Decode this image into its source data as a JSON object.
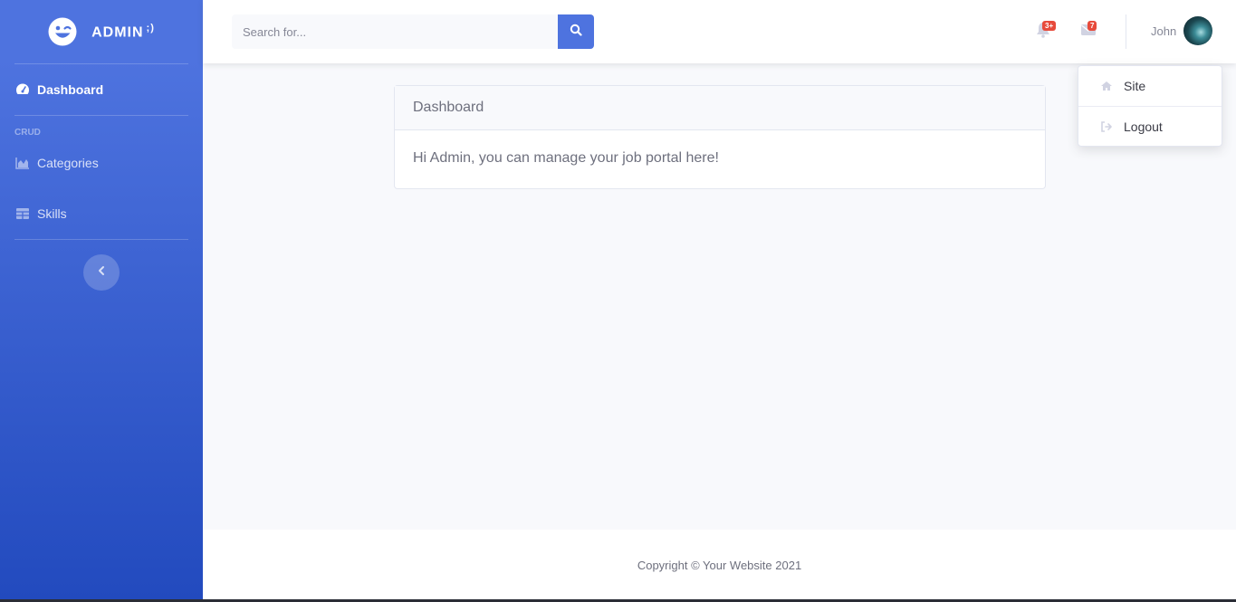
{
  "brand": {
    "name": "ADMIN",
    "suffix": ";)"
  },
  "sidebar": {
    "items": [
      {
        "label": "Dashboard",
        "icon": "dashboard-gauge-icon",
        "active": true
      }
    ],
    "heading": "CRUD",
    "crud_items": [
      {
        "label": "Categories",
        "icon": "area-chart-icon"
      },
      {
        "label": "Skills",
        "icon": "table-icon"
      }
    ]
  },
  "search": {
    "placeholder": "Search for..."
  },
  "topbar": {
    "alerts_badge": "3+",
    "messages_badge": "7",
    "user_name": "John"
  },
  "user_menu": {
    "items": [
      {
        "label": "Site",
        "icon": "home-icon"
      },
      {
        "label": "Logout",
        "icon": "sign-out-icon"
      }
    ]
  },
  "card": {
    "title": "Dashboard",
    "body": "Hi Admin, you can manage your job portal here!"
  },
  "footer": {
    "text": "Copyright © Your Website 2021"
  },
  "colors": {
    "primary": "#4e73df",
    "primary_dark": "#224abe",
    "badge": "#e74a3b"
  }
}
